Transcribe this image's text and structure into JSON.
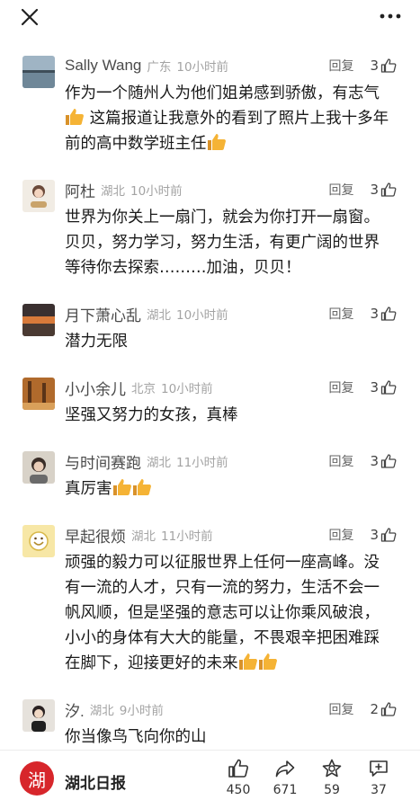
{
  "top": {
    "close_icon": "close-icon",
    "more_icon": "more-icon"
  },
  "comments": [
    {
      "user": "Sally Wang",
      "location": "广东",
      "time": "10小时前",
      "reply": "回复",
      "likes": "3",
      "lines": [
        "作为一个随州人为他们姐弟感到骄傲，有志气",
        "这篇报道让我意外的看到了照片上我十多年",
        "前的高中数学班主任"
      ]
    },
    {
      "user": "阿杜",
      "location": "湖北",
      "time": "10小时前",
      "reply": "回复",
      "likes": "3",
      "lines": [
        "世界为你关上一扇门，就会为你打开一扇窗。",
        "贝贝，努力学习，努力生活，有更广阔的世界",
        "等待你去探索………加油，贝贝！"
      ]
    },
    {
      "user": "月下萧心乱",
      "location": "湖北",
      "time": "10小时前",
      "reply": "回复",
      "likes": "3",
      "lines": [
        "潜力无限"
      ]
    },
    {
      "user": "小小余儿",
      "location": "北京",
      "time": "10小时前",
      "reply": "回复",
      "likes": "3",
      "lines": [
        "坚强又努力的女孩，真棒"
      ]
    },
    {
      "user": "与时间赛跑",
      "location": "湖北",
      "time": "11小时前",
      "reply": "回复",
      "likes": "3",
      "lines": [
        "真厉害"
      ]
    },
    {
      "user": "早起很烦",
      "location": "湖北",
      "time": "11小时前",
      "reply": "回复",
      "likes": "3",
      "lines": [
        "顽强的毅力可以征服世界上任何一座高峰。没",
        "有一流的人才，只有一流的努力，生活不会一",
        "帆风顺，但是坚强的意志可以让你乘风破浪，",
        "小小的身体有大大的能量，不畏艰辛把困难踩",
        "在脚下，迎接更好的未来"
      ]
    },
    {
      "user": "汐.",
      "location": "湖北",
      "time": "9小时前",
      "reply": "回复",
      "likes": "2",
      "lines": [
        "你当像鸟飞向你的山"
      ]
    }
  ],
  "bottom": {
    "logo_char": "湖",
    "brand": "湖北日报",
    "like_count": "450",
    "share_count": "671",
    "collect_count": "59",
    "comment_count": "37"
  },
  "colors": {
    "brand_red": "#d7262b",
    "emoji_thumb": "#f5b335"
  }
}
